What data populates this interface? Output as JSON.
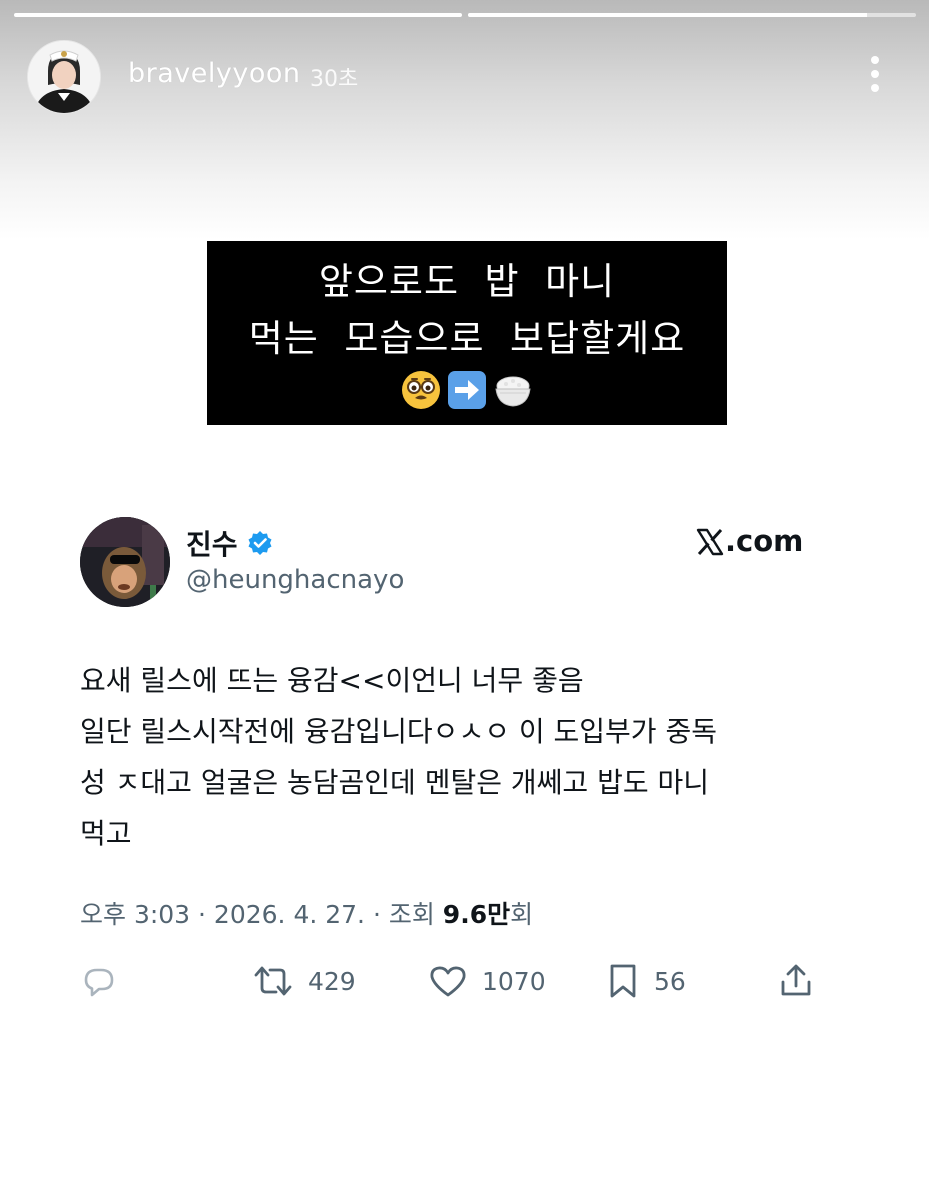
{
  "story": {
    "progress": [
      1.0,
      0.89
    ],
    "username": "bravelyyoon",
    "time": "30초",
    "caption_lines": [
      "앞으로도  밥  마니",
      "먹는  모습으로  보답할게요"
    ],
    "caption_emojis": [
      "nerd-face-emoji",
      "right-arrow-emoji",
      "rice-bowl-emoji"
    ]
  },
  "tweet": {
    "display_name": "진수",
    "handle": "@heunghacnayo",
    "source_domain": ".com",
    "body_lines": [
      "요새 릴스에 뜨는 융감<<이언니 너무 좋음",
      "일단 릴스시작전에 융감입니다ㅇㅅㅇ 이 도입부가 중독",
      "성 ㅈ대고 얼굴은 농담곰인데 멘탈은 개쎄고 밥도 마니",
      "먹고"
    ],
    "meta_prefix": "오후 3:03 · 2026. 4. 27. · 조회 ",
    "views_count": "9.6만",
    "views_suffix": "회",
    "retweets": "429",
    "likes": "1070",
    "bookmarks": "56"
  },
  "colors": {
    "secondary_text": "#536471",
    "verified_blue": "#1d9bf0",
    "caption_bg": "#000000"
  }
}
